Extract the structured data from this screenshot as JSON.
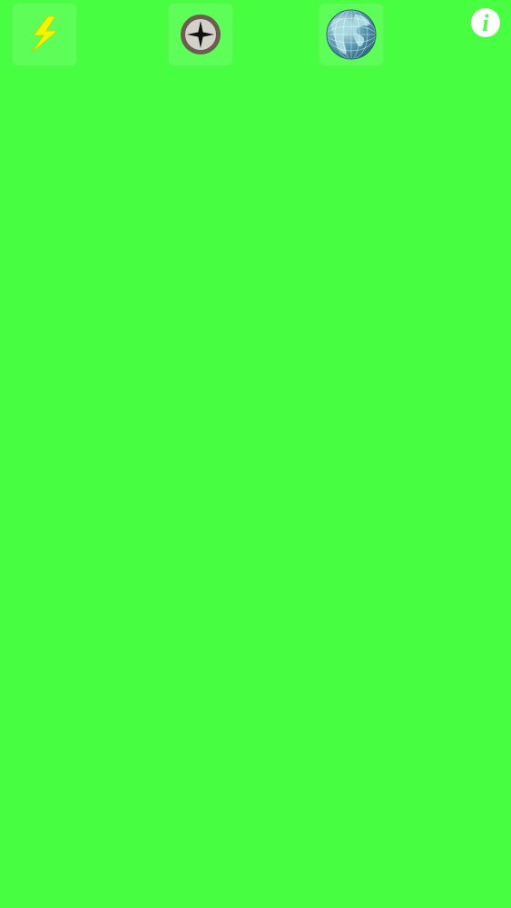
{
  "screen": {
    "background_color": "#48fe41"
  },
  "toolbar": {
    "buttons": [
      {
        "id": "flash",
        "icon": "lightning-bolt-icon"
      },
      {
        "id": "compass",
        "icon": "compass-icon"
      },
      {
        "id": "globe",
        "icon": "globe-icon"
      }
    ],
    "info": {
      "icon": "info-icon",
      "letter": "i"
    }
  },
  "colors": {
    "bolt_fill": "#f2f500",
    "compass_ring": "#6b5e4f",
    "compass_face": "#d4d0ca",
    "globe_ocean": "#5f9eb4",
    "globe_land": "#a8d9e2",
    "info_fill": "#ffffff",
    "info_letter": "#48fe41"
  }
}
